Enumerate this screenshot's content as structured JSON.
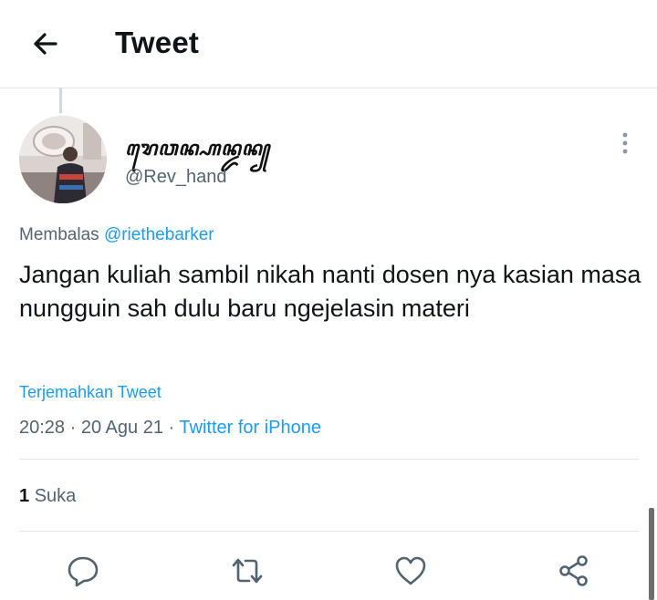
{
  "header": {
    "title": "Tweet",
    "back_icon": "arrow-left-icon"
  },
  "tweet": {
    "author": {
      "display_name": "ꦫꦺꦮꦤ꧀ꦲꦤ꧀ꦢꦤ꧀",
      "handle": "@Rev_hand"
    },
    "reply_prefix": "Membalas",
    "reply_to": "@riethebarker",
    "text": "Jangan kuliah sambil nikah nanti dosen nya kasian masa nungguin sah dulu baru ngejelasin materi",
    "translate_label": "Terjemahkan Tweet",
    "time": "20:28",
    "date": "20 Agu 21",
    "separator": "·",
    "source": "Twitter for iPhone"
  },
  "stats": {
    "likes_count": "1",
    "likes_label": "Suka"
  },
  "actions": [
    {
      "name": "reply-icon"
    },
    {
      "name": "retweet-icon"
    },
    {
      "name": "like-icon"
    },
    {
      "name": "share-icon"
    }
  ],
  "colors": {
    "accent": "#1d9bf0",
    "secondary_text": "#536471",
    "divider": "#e3e6e8"
  }
}
